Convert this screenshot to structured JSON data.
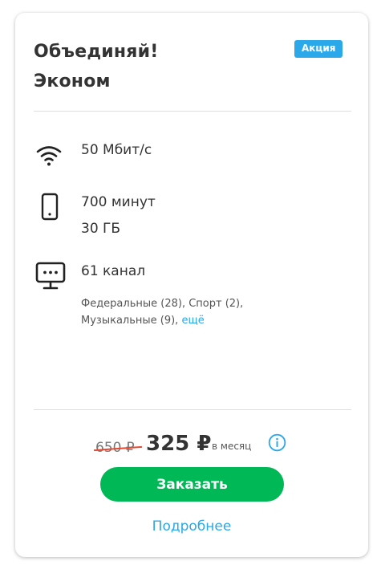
{
  "title": {
    "line1": "Объединяй!",
    "line2": "Эконом"
  },
  "badge": "Акция",
  "features": {
    "internet": {
      "icon": "wifi-icon",
      "text": "50 Мбит/с"
    },
    "mobile": {
      "icon": "smartphone-icon",
      "minutes": "700 минут",
      "data": "30 ГБ"
    },
    "tv": {
      "icon": "tv-icon",
      "channels": "61 канал",
      "desc_line1": "Федеральные (28), Спорт (2),",
      "desc_line2": "Музыкальные (9),",
      "more": "ещё"
    }
  },
  "price": {
    "old": "650 ₽",
    "new": "325 ₽",
    "period": "в месяц",
    "info_icon": "info-icon"
  },
  "actions": {
    "order": "Заказать",
    "details": "Подробнее"
  },
  "colors": {
    "accent": "#2ba8e9",
    "order_button": "#00b956",
    "strike": "#e64a33",
    "text": "#333333"
  }
}
